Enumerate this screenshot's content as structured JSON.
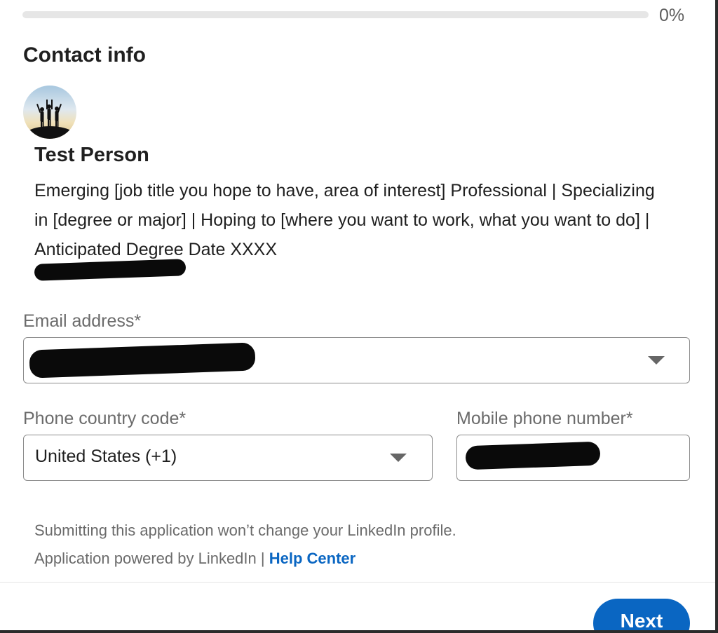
{
  "progress": {
    "percent_label": "0%",
    "value": 0
  },
  "section": {
    "title": "Contact info"
  },
  "profile": {
    "avatar_icon": "profile-photo-silhouettes",
    "name": "Test Person",
    "headline": "Emerging [job title you hope to have, area of interest] Professional | Specializing in [degree or major] | Hoping to [where you want to work, what you want to do] | Anticipated Degree Date XXXX"
  },
  "form": {
    "email": {
      "label": "Email address*",
      "value": ""
    },
    "phone_country": {
      "label": "Phone country code*",
      "value": "United States (+1)"
    },
    "mobile": {
      "label": "Mobile phone number*",
      "value": ""
    }
  },
  "footer": {
    "notice": "Submitting this application won’t change your LinkedIn profile.",
    "powered_by": "Application powered by LinkedIn | ",
    "help_link": "Help Center"
  },
  "actions": {
    "next_label": "Next"
  },
  "colors": {
    "accent": "#0a66c2",
    "redaction": "#0a0a0a"
  }
}
